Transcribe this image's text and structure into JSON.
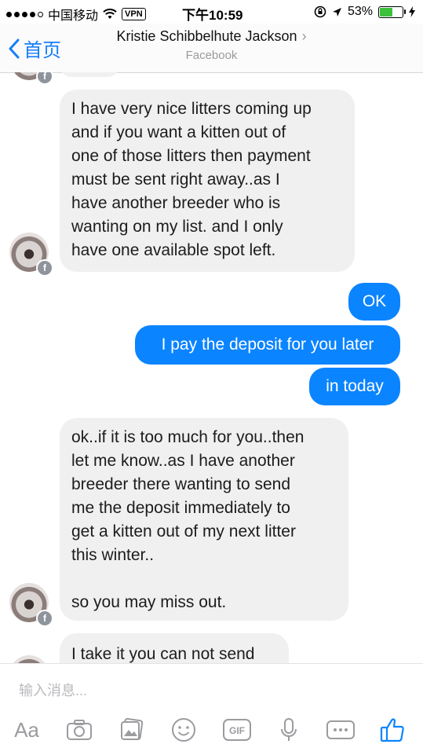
{
  "status_bar": {
    "carrier": "中国移动",
    "vpn": "VPN",
    "time": "下午10:59",
    "battery": "53%",
    "battery_color": "#3cc13c"
  },
  "nav": {
    "back_label": "首页",
    "title": "Kristie Schibbelhute Jackson",
    "subtitle": "Facebook"
  },
  "messages": [
    {
      "from": "them",
      "lines": [
        "I have very nice litters coming up",
        "and if you want a kitten out of",
        "one of those litters then payment",
        "must be sent right away..as I",
        "have another breeder who is",
        "wanting on my list.  and I only",
        "have one available spot left."
      ]
    },
    {
      "from": "me",
      "text": "OK"
    },
    {
      "from": "me",
      "text": "I pay the deposit for you later"
    },
    {
      "from": "me",
      "text": "in today"
    },
    {
      "from": "them",
      "lines": [
        "ok..if it is too much for you..then",
        "let me know..as I have another",
        "breeder there wanting to send",
        "me the deposit immediately to",
        "get a kitten out of my next litter",
        "this winter..",
        "",
        "so you may miss out."
      ]
    },
    {
      "from": "them",
      "lines": [
        "I take it you can not send"
      ]
    }
  ],
  "composer": {
    "placeholder": "输入消息...",
    "toolbar": [
      "text-format-icon",
      "camera-icon",
      "gallery-icon",
      "emoji-icon",
      "gif-icon",
      "microphone-icon",
      "more-icon",
      "like-icon"
    ],
    "aa_label": "Aa",
    "gif_label": "GIF",
    "accent": "#0b84ff"
  }
}
